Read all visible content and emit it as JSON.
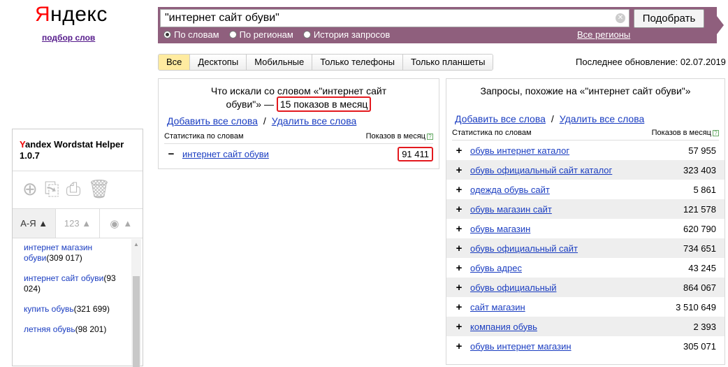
{
  "logo": {
    "text_first": "Я",
    "text_rest": "ндекс",
    "sub": "подбор слов"
  },
  "search": {
    "value": "\"интернет сайт обуви\"",
    "button": "Подобрать"
  },
  "radios": [
    {
      "label": "По словам",
      "on": true
    },
    {
      "label": "По регионам",
      "on": false
    },
    {
      "label": "История запросов",
      "on": false
    }
  ],
  "regions": "Все регионы",
  "tabs": [
    {
      "label": "Все",
      "active": true
    },
    {
      "label": "Десктопы"
    },
    {
      "label": "Мобильные"
    },
    {
      "label": "Только телефоны"
    },
    {
      "label": "Только планшеты"
    }
  ],
  "updated": "Последнее обновление: 02.07.2019",
  "left": {
    "title_a": "Что искали со словом «\"интернет сайт",
    "title_b": "обуви\"» — ",
    "title_hl": "15 показов в месяц",
    "add_all": "Добавить все слова",
    "sep": "/",
    "del_all": "Удалить все слова",
    "col1": "Статистика по словам",
    "col2": "Показов в месяц",
    "help": "?",
    "rows": [
      {
        "sign": "−",
        "word": "интернет сайт обуви",
        "count": "91 411"
      }
    ]
  },
  "right": {
    "title": "Запросы, похожие на «\"интернет сайт обуви\"»",
    "add_all": "Добавить все слова",
    "sep": "/",
    "del_all": "Удалить все слова",
    "col1": "Статистика по словам",
    "col2": "Показов в месяц",
    "help": "?",
    "rows": [
      {
        "sign": "+",
        "word": "обувь интернет каталог",
        "count": "57 955"
      },
      {
        "sign": "+",
        "word": "обувь официальный сайт каталог",
        "count": "323 403"
      },
      {
        "sign": "+",
        "word": "одежда обувь сайт",
        "count": "5 861"
      },
      {
        "sign": "+",
        "word": "обувь магазин сайт",
        "count": "121 578"
      },
      {
        "sign": "+",
        "word": "обувь магазин",
        "count": "620 790"
      },
      {
        "sign": "+",
        "word": "обувь официальный сайт",
        "count": "734 651"
      },
      {
        "sign": "+",
        "word": "обувь адрес",
        "count": "43 245"
      },
      {
        "sign": "+",
        "word": "обувь официальный",
        "count": "864 067"
      },
      {
        "sign": "+",
        "word": "сайт магазин",
        "count": "3 510 649"
      },
      {
        "sign": "+",
        "word": "компания обувь",
        "count": "2 393"
      },
      {
        "sign": "+",
        "word": "обувь интернет магазин",
        "count": "305 071"
      }
    ]
  },
  "helper": {
    "title_y": "Y",
    "title_rest": "andex Wordstat Helper",
    "version": "1.0.7",
    "sort": [
      {
        "label": "А-Я ▲"
      },
      {
        "label": "123 ▲"
      },
      {
        "label": "▲"
      }
    ],
    "items": [
      {
        "text": "интернет магазин обуви",
        "count": "(309 017)"
      },
      {
        "text": "интернет сайт обуви",
        "count": "(93 024)"
      },
      {
        "text": "купить обувь",
        "count": "(321 699)"
      },
      {
        "text": "летняя обувь",
        "count": "(98 201)"
      }
    ]
  }
}
